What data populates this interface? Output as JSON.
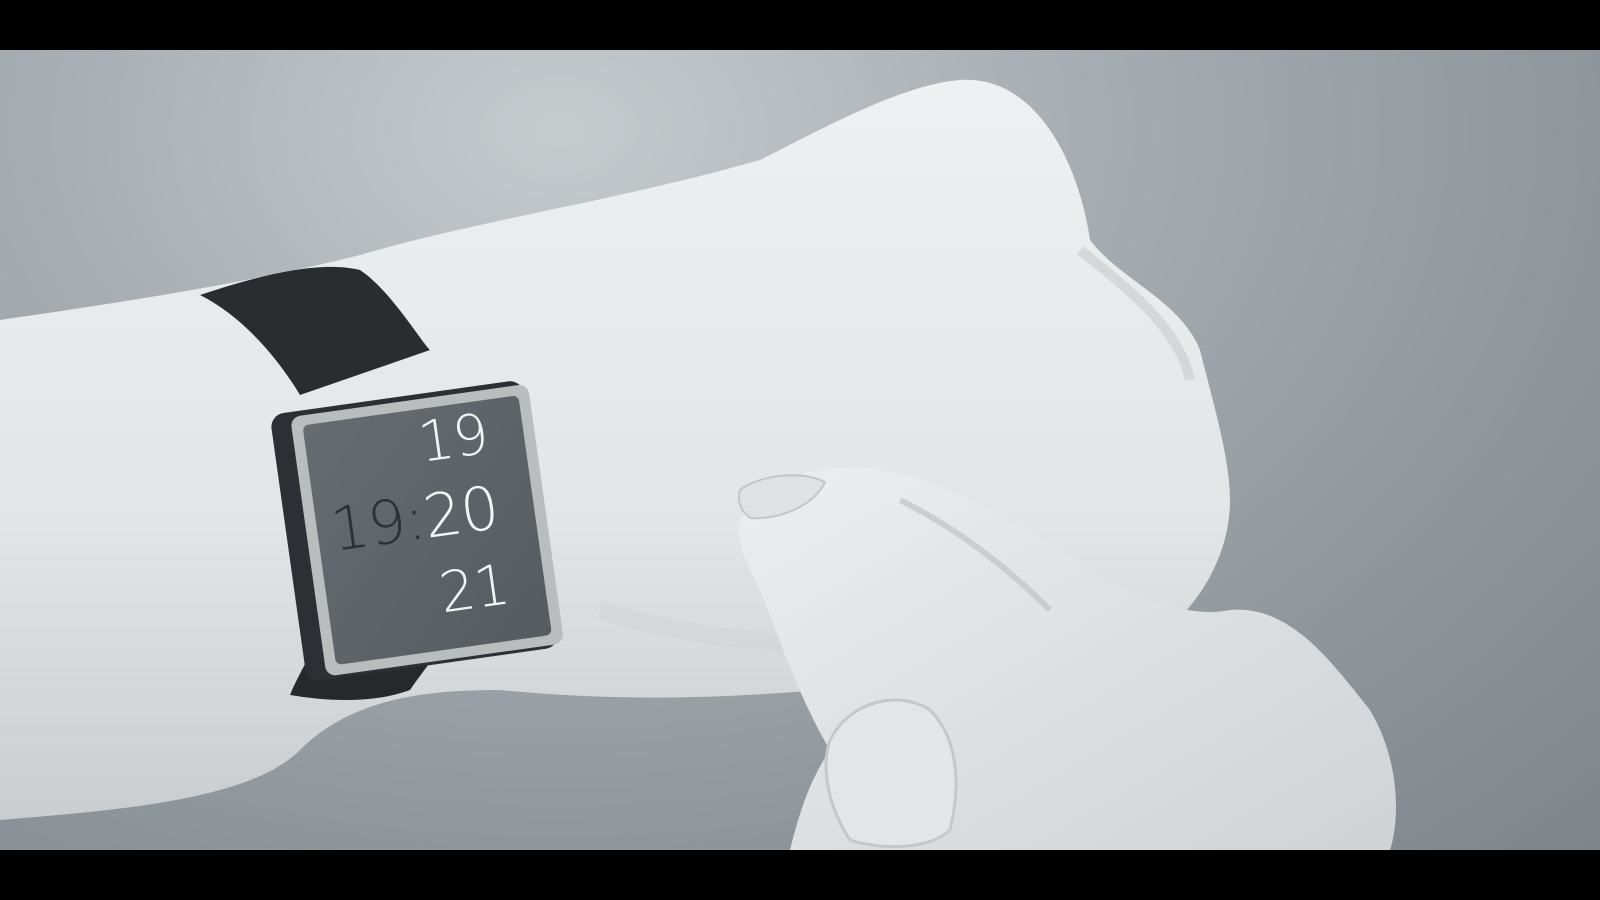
{
  "watch": {
    "hour_prev": "19",
    "time_hour": "19",
    "time_separator": ":",
    "time_minute": "20",
    "hour_next": "21"
  },
  "colors": {
    "background": "#9aa1a6",
    "skin": "#e6e9ea",
    "strap": "#2a2d30",
    "bezel": "#b7bbbc",
    "screen": "#5d6368",
    "screen_text": "#f2f4f4",
    "screen_text_dark": "#2d3034",
    "letterbox": "#000000"
  }
}
